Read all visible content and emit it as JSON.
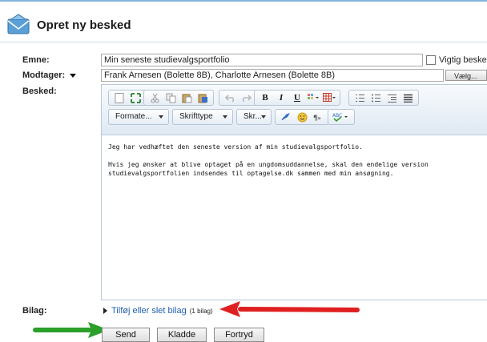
{
  "header": {
    "title": "Opret ny besked",
    "icon": "envelope-icon"
  },
  "form": {
    "subject": {
      "label": "Emne:",
      "value": "Min seneste studievalgsportfolio"
    },
    "important": {
      "label": "Vigtig besked",
      "checked": false
    },
    "recipients": {
      "label": "Modtager:",
      "value": "Frank Arnesen (Bolette 8B), Charlotte Arnesen (Bolette 8B)",
      "choose_label": "Vælg..."
    },
    "message": {
      "label": "Besked:"
    },
    "attachments": {
      "label": "Bilag:",
      "link": "Tilføj eller slet bilag",
      "count": "(1 bilag)"
    }
  },
  "editor": {
    "format_label": "Formate...",
    "font_label": "Skrifttype",
    "size_label": "Skr...",
    "toolbar_icons": [
      "new-page-icon",
      "maximize-icon",
      "cut-icon",
      "copy-icon",
      "paste-icon",
      "paste-word-icon",
      "undo-icon",
      "redo-icon",
      "bold-icon",
      "italic-icon",
      "underline-icon",
      "text-color-icon",
      "table-icon",
      "ordered-list-icon",
      "bullet-list-icon",
      "outdent-icon",
      "indent-icon",
      "link-icon",
      "smiley-icon",
      "unlink-icon",
      "spellcheck-icon"
    ],
    "bold": "B",
    "italic": "I",
    "underline": "U",
    "body": [
      "Jeg har vedhæftet den seneste version af min studievalgsportfolio.",
      "Hvis jeg ønsker at blive optaget på en ungdomsuddannelse, skal den endelige version studievalgsportfolien indsendes til optagelse.dk sammen med min ansøgning."
    ]
  },
  "buttons": {
    "send": "Send",
    "draft": "Kladde",
    "cancel": "Fortryd"
  },
  "colors": {
    "accent": "#7fb6dc",
    "link": "#1f5fae",
    "red_arrow": "#e02020",
    "green_arrow": "#2aa02a"
  }
}
